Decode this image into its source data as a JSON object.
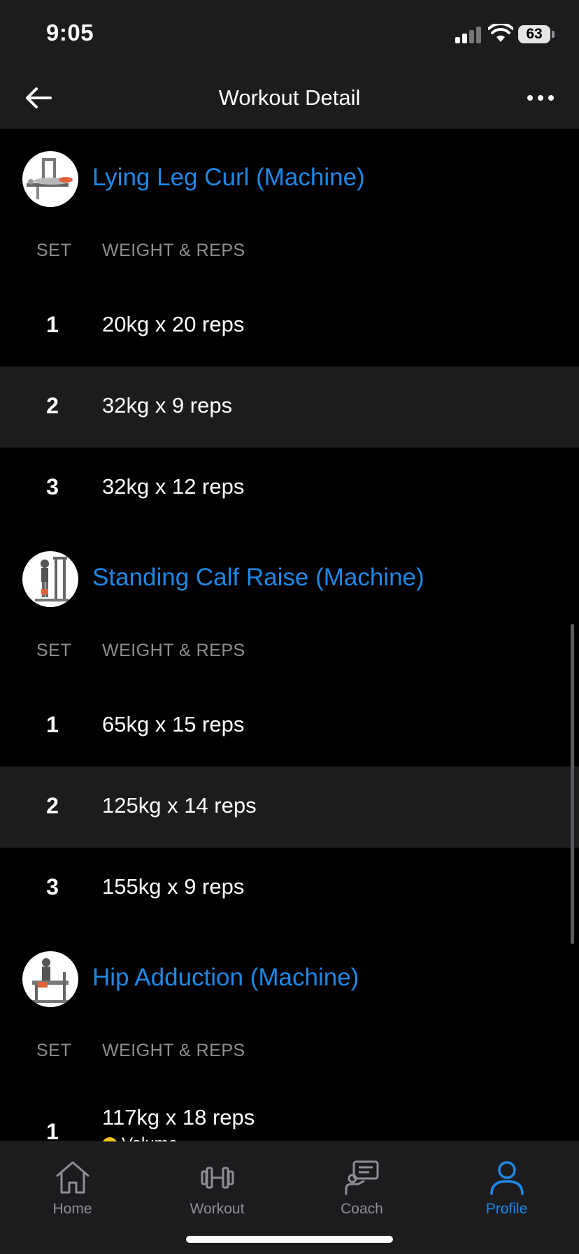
{
  "status": {
    "time": "9:05",
    "battery": "63"
  },
  "nav": {
    "title": "Workout Detail"
  },
  "columns": {
    "set": "SET",
    "weight_reps": "WEIGHT & REPS"
  },
  "exercises": [
    {
      "name": "Lying Leg Curl (Machine)",
      "sets": [
        {
          "set": "1",
          "value": "20kg x 20 reps"
        },
        {
          "set": "2",
          "value": "32kg x 9 reps"
        },
        {
          "set": "3",
          "value": "32kg x 12 reps"
        }
      ]
    },
    {
      "name": "Standing Calf Raise (Machine)",
      "sets": [
        {
          "set": "1",
          "value": "65kg x 15 reps"
        },
        {
          "set": "2",
          "value": "125kg x 14 reps"
        },
        {
          "set": "3",
          "value": "155kg x 9 reps"
        }
      ]
    },
    {
      "name": "Hip Adduction (Machine)",
      "sets": [
        {
          "set": "1",
          "value": "117kg x 18 reps",
          "tag": "Volume"
        }
      ]
    }
  ],
  "tabs": [
    {
      "label": "Home",
      "icon": "home-icon"
    },
    {
      "label": "Workout",
      "icon": "dumbbell-icon"
    },
    {
      "label": "Coach",
      "icon": "coach-icon"
    },
    {
      "label": "Profile",
      "icon": "profile-icon"
    }
  ],
  "colors": {
    "accent": "#1e88e5",
    "tag_dot": "#f5c518"
  }
}
